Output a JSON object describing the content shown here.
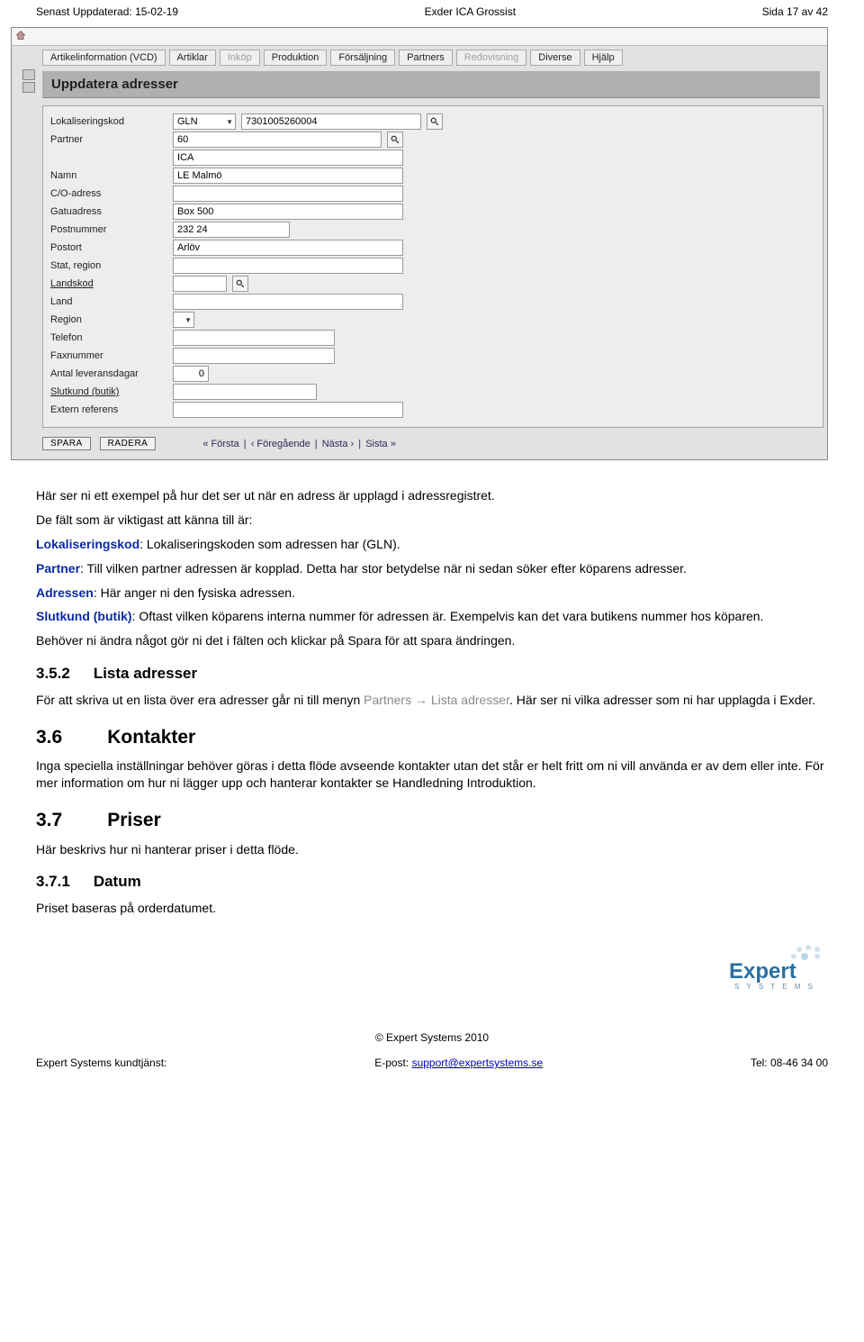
{
  "header": {
    "left": "Senast Uppdaterad: 15-02-19",
    "center": "Exder ICA Grossist",
    "right": "Sida 17 av 42"
  },
  "app": {
    "menu": [
      "Artikelinformation (VCD)",
      "Artiklar",
      "Inköp",
      "Produktion",
      "Försäljning",
      "Partners",
      "Redovisning",
      "Diverse",
      "Hjälp"
    ],
    "menu_dim": [
      2,
      6
    ],
    "section_title": "Uppdatera adresser",
    "fields": {
      "lokaliseringskod": {
        "label": "Lokaliseringskod",
        "select": "GLN",
        "value": "7301005260004"
      },
      "partner": {
        "label": "Partner",
        "value1": "60",
        "value2": "ICA"
      },
      "namn": {
        "label": "Namn",
        "value": "LE Malmö"
      },
      "co": {
        "label": "C/O-adress",
        "value": ""
      },
      "gatu": {
        "label": "Gatuadress",
        "value": "Box 500"
      },
      "postnr": {
        "label": "Postnummer",
        "value": "232 24"
      },
      "postort": {
        "label": "Postort",
        "value": "Arlöv"
      },
      "stat": {
        "label": "Stat, region",
        "value": ""
      },
      "landskod": {
        "label": "Landskod",
        "value": ""
      },
      "land": {
        "label": "Land",
        "value": ""
      },
      "region": {
        "label": "Region",
        "select": ""
      },
      "telefon": {
        "label": "Telefon",
        "value": ""
      },
      "fax": {
        "label": "Faxnummer",
        "value": ""
      },
      "leveransdagar": {
        "label": "Antal leveransdagar",
        "value": "0"
      },
      "slutkund": {
        "label": "Slutkund (butik)",
        "value": ""
      },
      "referens": {
        "label": "Extern referens",
        "value": ""
      }
    },
    "buttons": {
      "save": "SPARA",
      "delete": "RADERA"
    },
    "nav": {
      "first": "« Första",
      "prev": "‹ Föregående",
      "next": "Nästa ›",
      "last": "Sista »"
    }
  },
  "doc": {
    "p_intro": "Här ser ni ett exempel på hur det ser ut när en adress är upplagd i adressregistret.",
    "p_fields": "De fält som är viktigast att känna till är:",
    "terms": {
      "lok_label": "Lokaliseringskod",
      "lok_text": ": Lokaliseringskoden som adressen har (GLN).",
      "partner_label": "Partner",
      "partner_text": ": Till vilken partner adressen är kopplad. Detta har stor betydelse när ni sedan söker efter köparens adresser.",
      "adressen_label": "Adressen",
      "adressen_text": ": Här anger ni den fysiska adressen.",
      "slutkund_label": "Slutkund (butik)",
      "slutkund_text": ": Oftast vilken köparens interna nummer för adressen är. Exempelvis kan det vara butikens nummer hos köparen."
    },
    "p_save": "Behöver ni ändra något gör ni det i fälten och klickar på Spara för att spara ändringen.",
    "s352_num": "3.5.2",
    "s352_title": "Lista adresser",
    "s352_text_a": "För att skriva ut en lista över era adresser går ni till menyn ",
    "s352_grey": "Partners → Lista adresser",
    "s352_text_b": ". Här ser ni vilka adresser som ni har upplagda i Exder.",
    "s36_num": "3.6",
    "s36_title": "Kontakter",
    "s36_text": "Inga speciella inställningar behöver göras i detta flöde avseende kontakter utan det står er helt fritt om ni vill använda er av dem eller inte. För mer information om hur ni lägger upp och hanterar kontakter se Handledning Introduktion.",
    "s37_num": "3.7",
    "s37_title": "Priser",
    "s37_text": "Här beskrivs hur ni hanterar priser i detta flöde.",
    "s371_num": "3.7.1",
    "s371_title": "Datum",
    "s371_text": "Priset baseras på orderdatumet."
  },
  "footer": {
    "copyright": "© Expert Systems 2010",
    "left": "Expert Systems kundtjänst:",
    "mid_label": "E-post: ",
    "mid_link": "support@expertsystems.se",
    "right": "Tel: 08-46 34 00",
    "logo_top": "Expert",
    "logo_bottom": "S Y S T E M S"
  }
}
